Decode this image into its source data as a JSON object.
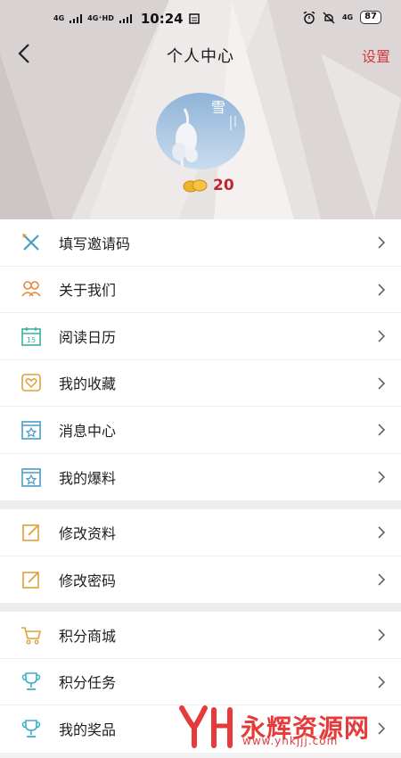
{
  "status_bar": {
    "signal_1": "4G",
    "signal_2": "4G⁺HD",
    "time": "10:24",
    "right_network": "4G",
    "battery": "87"
  },
  "header": {
    "title": "个人中心",
    "settings_label": "设置",
    "avatar_text": "雪",
    "points_value": "20"
  },
  "menu_groups": [
    [
      {
        "label": "填写邀请码",
        "icon": "pencil-cross-icon"
      },
      {
        "label": "关于我们",
        "icon": "users-icon"
      },
      {
        "label": "阅读日历",
        "icon": "calendar-icon"
      },
      {
        "label": "我的收藏",
        "icon": "heart-box-icon"
      },
      {
        "label": "消息中心",
        "icon": "star-box-icon"
      },
      {
        "label": "我的爆料",
        "icon": "star-box-icon"
      }
    ],
    [
      {
        "label": "修改资料",
        "icon": "edit-icon"
      },
      {
        "label": "修改密码",
        "icon": "edit-icon"
      }
    ],
    [
      {
        "label": "积分商城",
        "icon": "cart-icon"
      },
      {
        "label": "积分任务",
        "icon": "trophy-icon"
      },
      {
        "label": "我的奖品",
        "icon": "trophy-icon"
      }
    ]
  ],
  "calendar_day": "15",
  "watermark": {
    "text": "永辉资源网",
    "url": "www.yhkjjj.com"
  },
  "colors": {
    "accent_red": "#d43a3f",
    "icon_blue": "#4a9cc8",
    "icon_orange": "#e0a03a",
    "icon_green": "#3ab09e"
  }
}
